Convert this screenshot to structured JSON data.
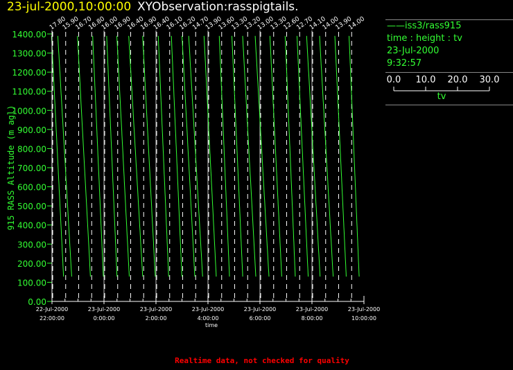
{
  "header": {
    "date": "23-jul-2000,10:00:00",
    "name": "XYObservation:rasspigtails."
  },
  "legend": {
    "series": "iss3/rass915",
    "axes": "time : height : tv",
    "date": "23-Jul-2000",
    "time": "9:32:57",
    "scale_ticks": [
      "0.0",
      "10.0",
      "20.0",
      "30.0"
    ],
    "scale_label": "tv"
  },
  "footer": "Realtime data, not checked for quality",
  "colors": {
    "trace": "#33ff33",
    "axis": "#ffffff",
    "grid": "#bbbbbb",
    "title": "#ffff00",
    "footer": "#ff0000"
  },
  "chart_data": {
    "type": "line",
    "ylabel": "915 RASS Altitude (m agl)",
    "xlabel": "time",
    "ylim": [
      0,
      1400
    ],
    "yticks": [
      "0.00",
      "100.00",
      "200.00",
      "300.00",
      "400.00",
      "500.00",
      "600.00",
      "700.00",
      "800.00",
      "900.00",
      "1000.00",
      "1100.00",
      "1200.00",
      "1300.00",
      "1400.00"
    ],
    "xlim": [
      "22-Jul-2000 22:00:00",
      "23-Jul-2000 10:00:00"
    ],
    "xticks": [
      {
        "date": "22-Jul-2000",
        "time": "22:00:00"
      },
      {
        "date": "23-Jul-2000",
        "time": "0:00:00"
      },
      {
        "date": "23-Jul-2000",
        "time": "2:00:00"
      },
      {
        "date": "23-Jul-2000",
        "time": "4:00:00"
      },
      {
        "date": "23-Jul-2000",
        "time": "6:00:00"
      },
      {
        "date": "23-Jul-2000",
        "time": "8:00:00"
      },
      {
        "date": "23-Jul-2000",
        "time": "10:00:00"
      }
    ],
    "profile_interval_hours": 0.5,
    "profile_labels": [
      "17.80",
      "15.90",
      "16.70",
      "16.80",
      "16.00",
      "16.90",
      "16.40",
      "16.90",
      "16.40",
      "16.10",
      "16.20",
      "14.70",
      "13.90",
      "13.60",
      "13.30",
      "13.20",
      "13.00",
      "13.30",
      "12.60",
      "12.70",
      "14.10",
      "14.00",
      "13.90",
      "14.00"
    ],
    "profile_height_range": [
      130,
      1400
    ],
    "tv_scale": [
      0,
      30
    ]
  }
}
